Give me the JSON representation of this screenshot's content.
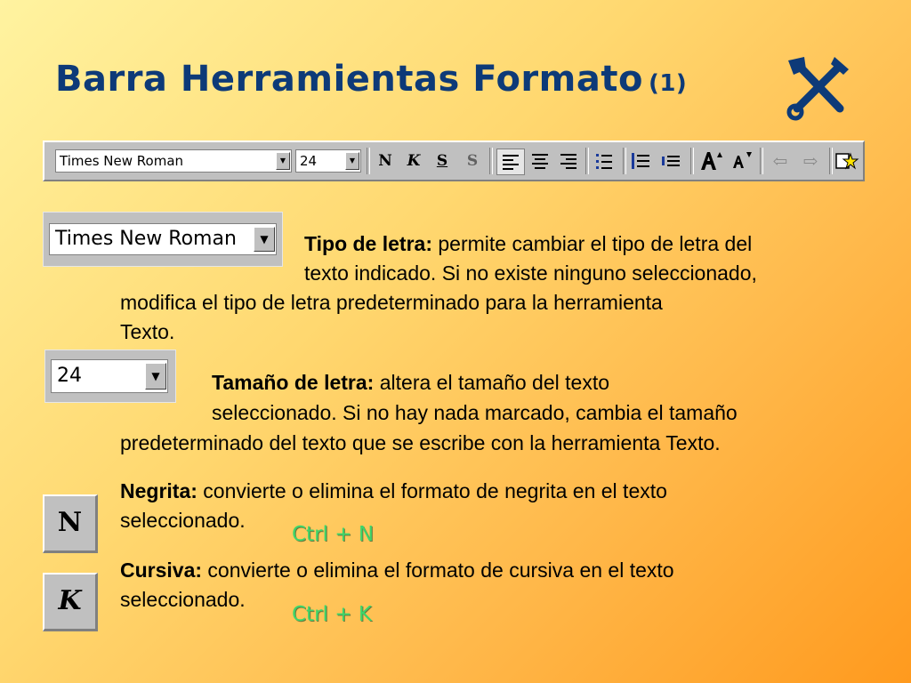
{
  "title": {
    "main": "Barra Herramientas Formato",
    "number": "(1)"
  },
  "toolbar": {
    "font_value": "Times New Roman",
    "size_value": "24",
    "bold_label": "N",
    "italic_label": "K",
    "underline_label": "S",
    "shadow_label": "S",
    "icons": [
      "align-left-icon",
      "align-center-icon",
      "align-right-icon",
      "bullets-icon",
      "increase-spacing-icon",
      "decrease-spacing-icon",
      "grow-font-icon",
      "shrink-font-icon",
      "promote-icon",
      "demote-icon",
      "animation-effects-icon"
    ]
  },
  "samples": {
    "font_value": "Times New Roman",
    "size_value": "24",
    "bold_label": "N",
    "italic_label": "K"
  },
  "descriptions": {
    "font": {
      "term": "Tipo de letra:",
      "line1": " permite cambiar el tipo de letra del",
      "line2": "texto indicado. Si no existe ninguno seleccionado,",
      "line3": "modifica el tipo de letra predeterminado para la herramienta",
      "line4": "Texto."
    },
    "size": {
      "term": "Tamaño de letra:",
      "line1": " altera el tamaño del texto",
      "line2": "seleccionado. Si no hay nada marcado, cambia el tamaño",
      "line3": "predeterminado del texto que se escribe con la herramienta Texto."
    },
    "bold": {
      "term": "Negrita:",
      "line1": " convierte o elimina el formato de negrita en el texto",
      "line2": "seleccionado.",
      "shortcut": "Ctrl + N"
    },
    "italic": {
      "term": "Cursiva:",
      "line1": " convierte o elimina el formato de cursiva en el texto",
      "line2": "seleccionado.",
      "shortcut": "Ctrl + K"
    }
  }
}
